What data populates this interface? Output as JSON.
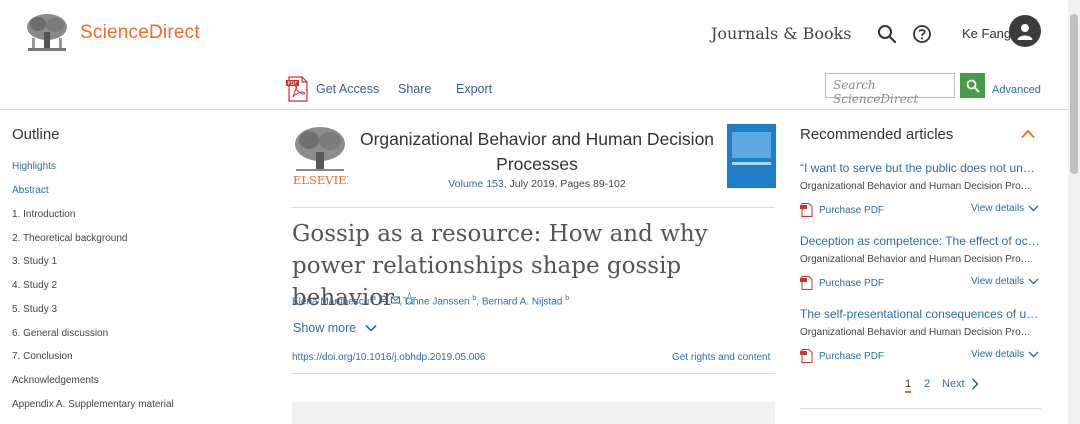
{
  "header": {
    "brand": "ScienceDirect",
    "journals_books": "Journals & Books",
    "user_name": "Ke Fang"
  },
  "toolbar": {
    "get_access": "Get Access",
    "share": "Share",
    "export": "Export",
    "search_placeholder": "Search ScienceDirect",
    "advanced": "Advanced"
  },
  "outline": {
    "title": "Outline",
    "items": [
      "Highlights",
      "Abstract",
      "1. Introduction",
      "2. Theoretical background",
      "3. Study 1",
      "4. Study 2",
      "5. Study 3",
      "6. General discussion",
      "7. Conclusion",
      "Acknowledgements",
      "Appendix A. Supplementary material"
    ]
  },
  "article": {
    "publisher": "ELSEVIER",
    "journal_title": "Organizational Behavior and Human Decision Processes",
    "volume": "Volume 153",
    "date_pages": ", July 2019, Pages 89-102",
    "title": "Gossip as a resource: How and why power relationships shape gossip behavior",
    "author1": "Elena Martinescu",
    "author1_sup": "a",
    "author2": "Onne Janssen",
    "author2_sup": "b",
    "author3": "Bernard A. Nijstad",
    "author3_sup": "b",
    "show_more": "Show more",
    "doi": "https://doi.org/10.1016/j.obhdp.2019.05.006",
    "rights": "Get rights and content"
  },
  "recommended": {
    "title": "Recommended articles",
    "items": [
      {
        "title": "“I want to serve but the public does not und…",
        "journal": "Organizational Behavior and Human Decision Pro…",
        "pdf": "Purchase PDF",
        "view": "View details"
      },
      {
        "title": "Deception as competence: The effect of occ…",
        "journal": "Organizational Behavior and Human Decision Pro…",
        "pdf": "Purchase PDF",
        "view": "View details"
      },
      {
        "title": "The self-presentational consequences of up…",
        "journal": "Organizational Behavior and Human Decision Pro…",
        "pdf": "Purchase PDF",
        "view": "View details"
      }
    ],
    "pages": [
      "1",
      "2"
    ],
    "next": "Next"
  },
  "colors": {
    "brand_orange": "#f06a2a",
    "link_blue": "#2f6e9e",
    "search_green": "#4a9b49"
  },
  "icons": [
    "search-icon",
    "help-icon",
    "user-icon",
    "pdf-icon",
    "star-icon",
    "chevron-down-icon",
    "chevron-up-icon",
    "chevron-right-icon"
  ]
}
